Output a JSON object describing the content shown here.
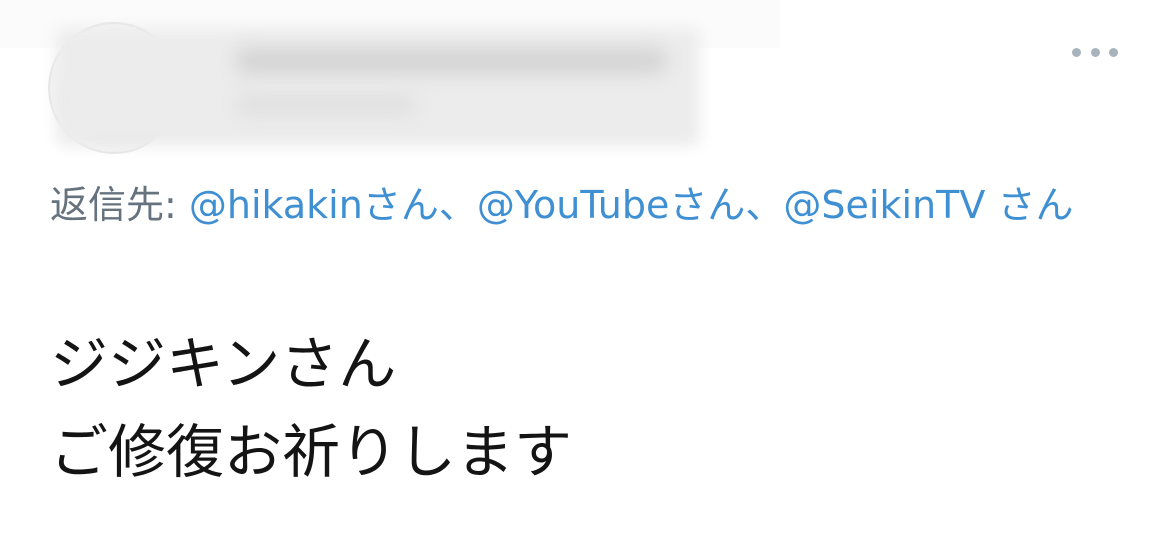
{
  "top_bar": {
    "glyphs": "〈 ﹏ ﹏ ﹏ 〉|  |"
  },
  "header": {
    "more_label": "•••"
  },
  "reply": {
    "prefix": "返信先:",
    "mentions": [
      {
        "handle": "@hikakin",
        "suffix": "さん"
      },
      {
        "handle": "@YouTube",
        "suffix": "さん"
      },
      {
        "handle": "@SeikinTV",
        "suffix": "さん"
      }
    ],
    "separator": "、"
  },
  "tweet": {
    "lines": [
      "ジジキンさん",
      "ご修復お祈りします"
    ]
  },
  "colors": {
    "link": "#3f8fd3",
    "muted": "#66737f",
    "text": "#141414",
    "more_dots": "#a8b3bd"
  }
}
